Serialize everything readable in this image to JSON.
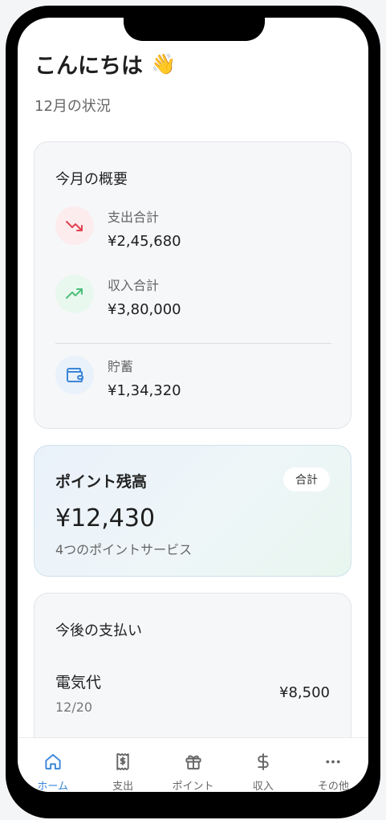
{
  "header": {
    "greeting": "こんにちは",
    "greeting_emoji": "👋",
    "subtitle": "12月の状況"
  },
  "overview": {
    "title": "今月の概要",
    "expense": {
      "label": "支出合計",
      "value": "¥2,45,680",
      "icon": "trending-down-icon"
    },
    "income": {
      "label": "収入合計",
      "value": "¥3,80,000",
      "icon": "trending-up-icon"
    },
    "savings": {
      "label": "貯蓄",
      "value": "¥1,34,320",
      "icon": "wallet-icon"
    }
  },
  "points": {
    "title": "ポイント残高",
    "badge": "合計",
    "amount": "¥12,430",
    "subtitle": "4つのポイントサービス"
  },
  "upcoming": {
    "title": "今後の支払い",
    "items": [
      {
        "name": "電気代",
        "date": "12/20",
        "amount": "¥8,500"
      }
    ]
  },
  "nav": {
    "items": [
      {
        "label": "ホーム",
        "icon": "home-icon",
        "active": true
      },
      {
        "label": "支出",
        "icon": "receipt-icon",
        "active": false
      },
      {
        "label": "ポイント",
        "icon": "gift-icon",
        "active": false
      },
      {
        "label": "収入",
        "icon": "dollar-icon",
        "active": false
      },
      {
        "label": "その他",
        "icon": "more-icon",
        "active": false
      }
    ]
  },
  "colors": {
    "accent": "#3b86d8",
    "expense": "#e0434f",
    "income": "#4cbf7a",
    "savings": "#3b86d8"
  }
}
